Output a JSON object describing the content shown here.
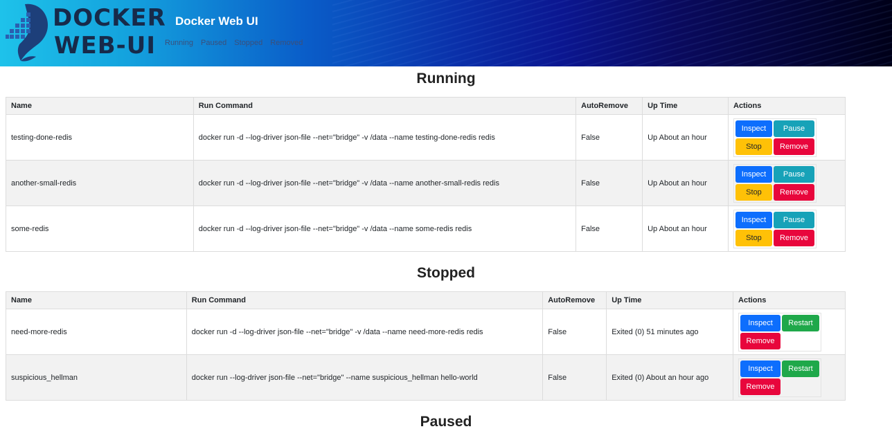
{
  "header": {
    "logo_line1": "DOCKER",
    "logo_line2": "WEB-UI",
    "title": "Docker Web UI",
    "nav": [
      "Running",
      "Paused",
      "Stopped",
      "Removed"
    ]
  },
  "sections": {
    "running_title": "Running",
    "stopped_title": "Stopped",
    "paused_title": "Paused"
  },
  "columns": {
    "name": "Name",
    "run_command": "Run Command",
    "auto_remove": "AutoRemove",
    "up_time": "Up Time",
    "actions": "Actions"
  },
  "buttons": {
    "inspect": "Inspect",
    "pause": "Pause",
    "stop": "Stop",
    "remove": "Remove",
    "restart": "Restart"
  },
  "running": [
    {
      "name": "testing-done-redis",
      "command": "docker run -d --log-driver json-file --net=\"bridge\" -v /data --name testing-done-redis redis",
      "auto_remove": "False",
      "up_time": "Up About an hour"
    },
    {
      "name": "another-small-redis",
      "command": "docker run -d --log-driver json-file --net=\"bridge\" -v /data --name another-small-redis redis",
      "auto_remove": "False",
      "up_time": "Up About an hour"
    },
    {
      "name": "some-redis",
      "command": "docker run -d --log-driver json-file --net=\"bridge\" -v /data --name some-redis redis",
      "auto_remove": "False",
      "up_time": "Up About an hour"
    }
  ],
  "stopped": [
    {
      "name": "need-more-redis",
      "command": "docker run -d --log-driver json-file --net=\"bridge\" -v /data --name need-more-redis redis",
      "auto_remove": "False",
      "up_time": "Exited (0) 51 minutes ago"
    },
    {
      "name": "suspicious_hellman",
      "command": "docker run --log-driver json-file --net=\"bridge\" --name suspicious_hellman hello-world",
      "auto_remove": "False",
      "up_time": "Exited (0) About an hour ago"
    }
  ],
  "colors": {
    "inspect": "#0d6efd",
    "pause": "#17a2b8",
    "stop": "#ffc107",
    "remove": "#e8063c",
    "restart": "#1fa84a"
  },
  "icons": {
    "logo": "whale-container-icon"
  }
}
